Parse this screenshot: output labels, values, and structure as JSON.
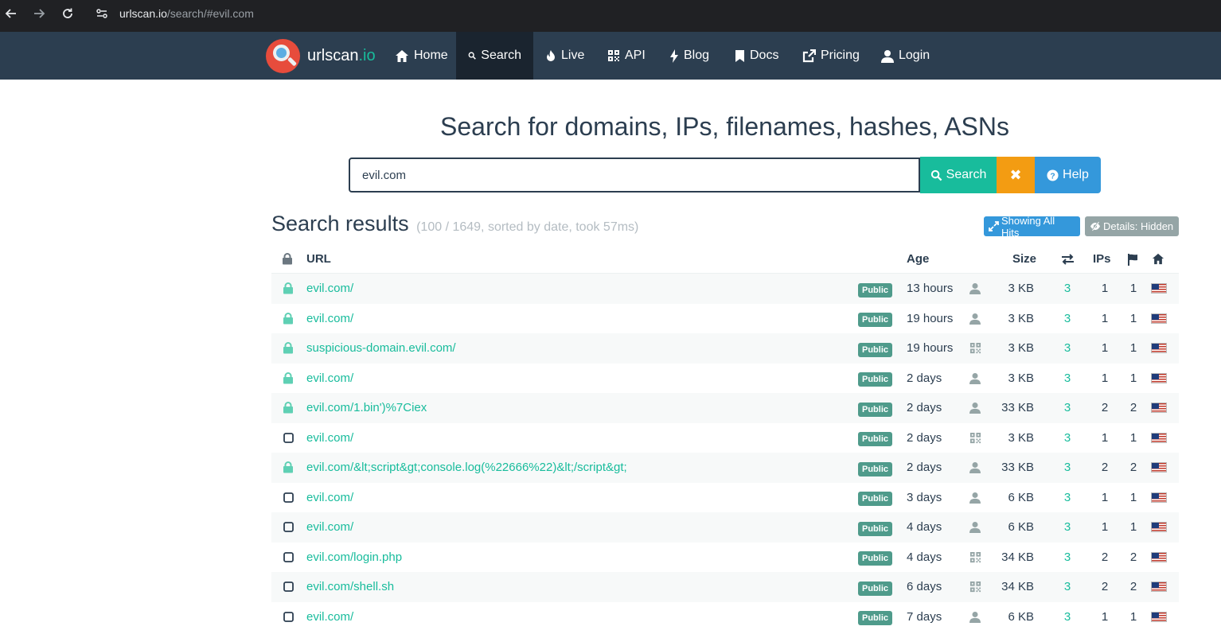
{
  "browser": {
    "url_host": "urlscan.io",
    "url_path": "/search/#evil.com"
  },
  "site": {
    "brand_name": "urlscan",
    "brand_tld": ".io",
    "nav": [
      {
        "label": "Home",
        "icon": "home-icon"
      },
      {
        "label": "Search",
        "icon": "search-icon",
        "active": true
      },
      {
        "label": "Live",
        "icon": "fire-icon"
      },
      {
        "label": "API",
        "icon": "qrcode-icon"
      },
      {
        "label": "Blog",
        "icon": "bolt-icon"
      },
      {
        "label": "Docs",
        "icon": "bookmark-icon"
      },
      {
        "label": "Pricing",
        "icon": "external-link-icon"
      },
      {
        "label": "Login",
        "icon": "user-icon"
      }
    ]
  },
  "search": {
    "headline": "Search for domains, IPs, filenames, hashes, ASNs",
    "query": "evil.com",
    "search_label": "Search",
    "clear_label": "✖",
    "help_label": "Help"
  },
  "results": {
    "title": "Search results",
    "meta": "(100 / 1649, sorted by date, took 57ms)",
    "showing_label": "Showing All Hits",
    "details_label": "Details: Hidden",
    "columns": {
      "url": "URL",
      "age": "Age",
      "size": "Size",
      "ips": "IPs"
    },
    "badge_label": "Public",
    "colors": {
      "accent": "#18bc9c",
      "navbar": "#2c3e50",
      "warning": "#f39c12",
      "info": "#3498db"
    },
    "rows": [
      {
        "locked": true,
        "url": "evil.com/",
        "age": "13 hours",
        "source": "user",
        "size": "3 KB",
        "requests": "3",
        "ips": "1",
        "countries": "1"
      },
      {
        "locked": true,
        "url": "evil.com/",
        "age": "19 hours",
        "source": "user",
        "size": "3 KB",
        "requests": "3",
        "ips": "1",
        "countries": "1"
      },
      {
        "locked": true,
        "url": "suspicious-domain.evil.com/",
        "age": "19 hours",
        "source": "api",
        "size": "3 KB",
        "requests": "3",
        "ips": "1",
        "countries": "1"
      },
      {
        "locked": true,
        "url": "evil.com/",
        "age": "2 days",
        "source": "user",
        "size": "3 KB",
        "requests": "3",
        "ips": "1",
        "countries": "1"
      },
      {
        "locked": true,
        "url": "evil.com/1.bin')%7Ciex",
        "age": "2 days",
        "source": "user",
        "size": "33 KB",
        "requests": "3",
        "ips": "2",
        "countries": "2"
      },
      {
        "locked": false,
        "url": "evil.com/",
        "age": "2 days",
        "source": "api",
        "size": "3 KB",
        "requests": "3",
        "ips": "1",
        "countries": "1"
      },
      {
        "locked": true,
        "url": "evil.com/&lt;script&gt;console.log(%22666%22)&lt;/script&gt;",
        "age": "2 days",
        "source": "user",
        "size": "33 KB",
        "requests": "3",
        "ips": "2",
        "countries": "2"
      },
      {
        "locked": false,
        "url": "evil.com/",
        "age": "3 days",
        "source": "user",
        "size": "6 KB",
        "requests": "3",
        "ips": "1",
        "countries": "1"
      },
      {
        "locked": false,
        "url": "evil.com/",
        "age": "4 days",
        "source": "user",
        "size": "6 KB",
        "requests": "3",
        "ips": "1",
        "countries": "1"
      },
      {
        "locked": false,
        "url": "evil.com/login.php",
        "age": "4 days",
        "source": "api",
        "size": "34 KB",
        "requests": "3",
        "ips": "2",
        "countries": "2"
      },
      {
        "locked": false,
        "url": "evil.com/shell.sh",
        "age": "6 days",
        "source": "api",
        "size": "34 KB",
        "requests": "3",
        "ips": "2",
        "countries": "2"
      },
      {
        "locked": false,
        "url": "evil.com/",
        "age": "7 days",
        "source": "user",
        "size": "6 KB",
        "requests": "3",
        "ips": "1",
        "countries": "1"
      }
    ]
  }
}
